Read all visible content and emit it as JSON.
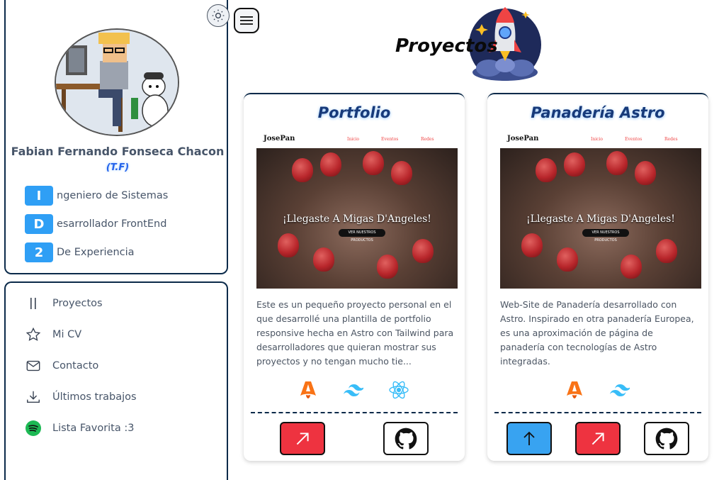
{
  "profile": {
    "name": "Fabian Fernando Fonseca Chacon",
    "nickname": "(T.F)",
    "roles": [
      {
        "letter": "I",
        "text": "ngeniero de Sistemas"
      },
      {
        "letter": "D",
        "text": "esarrollador FrontEnd"
      },
      {
        "letter": "2",
        "text": "De Experiencia"
      }
    ]
  },
  "nav": {
    "items": [
      {
        "label": "Proyectos",
        "icon": "pause-bars-icon"
      },
      {
        "label": "Mi CV",
        "icon": "star-icon"
      },
      {
        "label": "Contacto",
        "icon": "mail-icon"
      },
      {
        "label": "Últimos trabajos",
        "icon": "download-icon"
      },
      {
        "label": "Lista Favorita :3",
        "icon": "spotify-icon"
      }
    ]
  },
  "header": {
    "title": "Proyectos"
  },
  "projects": [
    {
      "title": "Portfolio",
      "preview": {
        "logo": "JosePan",
        "links": [
          "Inicio",
          "Eventos",
          "Redes"
        ],
        "hero_text": "¡Llegaste A Migas D'Angeles!",
        "hero_button": "VER NUESTROS PRODUCTOS"
      },
      "description": "Este es un pequeño proyecto personal en el que desarrollé una plantilla de portfolio responsive hecha en Astro con Tailwind para desarrolladores que quieran mostrar sus proyectos y no tengan mucho tie...",
      "tech": [
        "astro-icon",
        "tailwind-icon",
        "react-icon"
      ]
    },
    {
      "title": "Panadería Astro",
      "preview": {
        "logo": "JosePan",
        "links": [
          "Inicio",
          "Eventos",
          "Redes"
        ],
        "hero_text": "¡Llegaste A Migas D'Angeles!",
        "hero_button": "VER NUESTROS PRODUCTOS"
      },
      "description": "Web-Site de Panadería desarrollado con Astro. Inspirado en otra panadería Europea, es una aproximación de página de panadería con tecnologías de Astro integradas.",
      "tech": [
        "astro-icon",
        "tailwind-icon"
      ]
    }
  ],
  "colors": {
    "accent_blue": "#2f9ff5",
    "dark_border": "#0b2a4a",
    "red_button": "#ee3340",
    "spotify_green": "#1db954"
  }
}
